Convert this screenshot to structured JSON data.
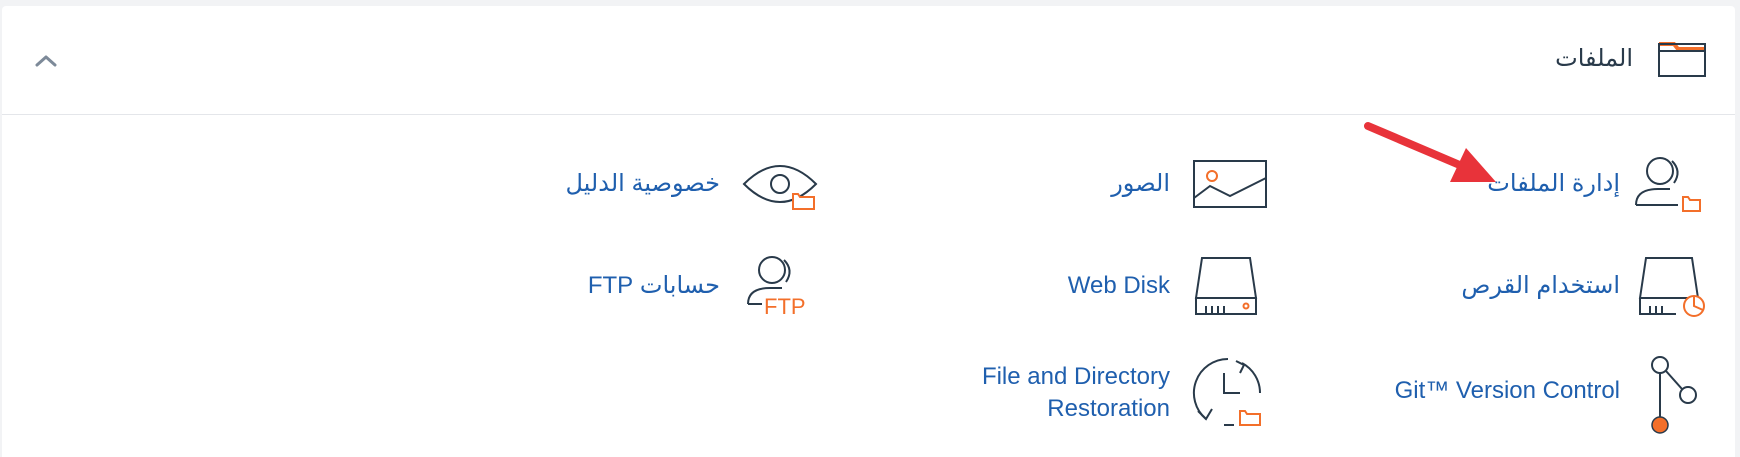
{
  "section": {
    "title": "الملفات",
    "icon": "folder-icon",
    "collapse_icon": "chevron-up-icon"
  },
  "items": [
    {
      "id": "file-manager",
      "label": "إدارة الملفات",
      "icon": "user-folder-icon"
    },
    {
      "id": "images",
      "label": "الصور",
      "icon": "image-icon"
    },
    {
      "id": "directory-privacy",
      "label": "خصوصية الدليل",
      "icon": "eye-folder-icon"
    },
    {
      "id": "disk-usage",
      "label": "استخدام القرص",
      "icon": "disk-chart-icon"
    },
    {
      "id": "web-disk",
      "label": "Web Disk",
      "icon": "disk-drive-icon"
    },
    {
      "id": "ftp-accounts",
      "label": "حسابات FTP",
      "icon": "user-ftp-icon",
      "icon_text": "FTP"
    },
    {
      "id": "git-version-control",
      "label": "Git™ Version Control",
      "icon": "git-branch-icon"
    },
    {
      "id": "file-restoration",
      "label": "File and Directory Restoration",
      "icon": "restore-icon"
    }
  ],
  "annotation": {
    "icon": "red-arrow-icon"
  },
  "colors": {
    "accent": "#f36f2a",
    "link": "#1f5fae",
    "icon_stroke": "#293a4a",
    "arrow": "#e8333a"
  }
}
